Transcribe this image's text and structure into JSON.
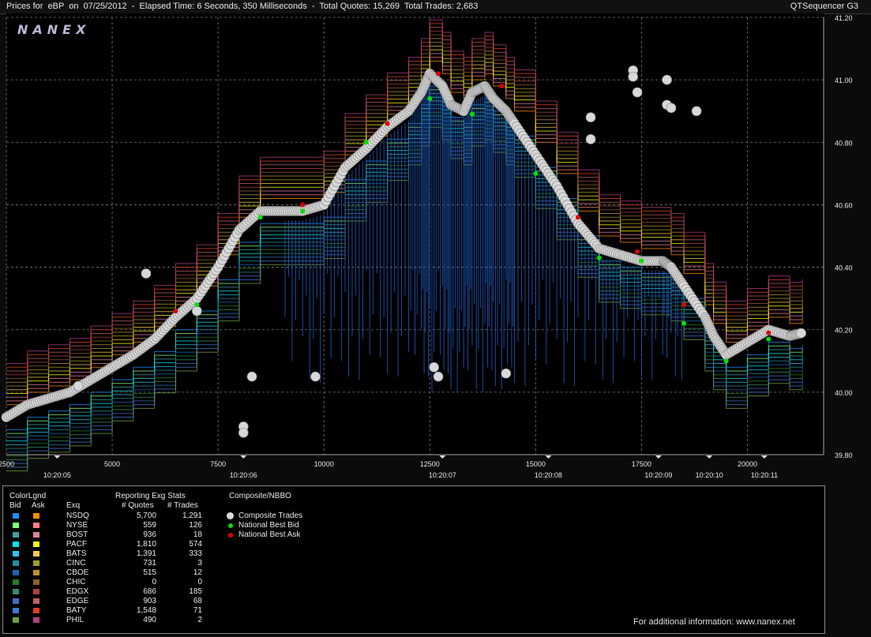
{
  "window": {
    "title": "Prices for  eBP  on  07/25/2012  -  Elapsed Time: 6 Seconds, 350 Milliseconds  -  Total Quotes: 15,269  Total Trades: 2,683",
    "app_name": "QTSequencer G3",
    "watermark": "NANEX"
  },
  "chart_data": {
    "type": "scatter",
    "ylim": [
      39.8,
      41.2
    ],
    "xlim": [
      2500,
      21800
    ],
    "y_ticks": [
      "41.20",
      "41.00",
      "40.80",
      "40.60",
      "40.40",
      "40.20",
      "40.00",
      "39.80"
    ],
    "x_ticks": [
      "2500",
      "5000",
      "7500",
      "10000",
      "12500",
      "15000",
      "17500",
      "20000"
    ],
    "time_labels": [
      "10:20:05",
      "10:20:06",
      "10:20:07",
      "10:20:08",
      "10:20:09",
      "10:20:10",
      "10:20:11"
    ],
    "time_label_x": [
      3700,
      8100,
      12800,
      15300,
      17900,
      19100,
      20400
    ],
    "grid": true,
    "series": [
      {
        "name": "Composite Trades",
        "color": "#d8d8d8",
        "x": [
          2500,
          3000,
          3500,
          4000,
          4500,
          5000,
          5500,
          6000,
          6500,
          7000,
          7500,
          8000,
          8500,
          9000,
          9500,
          10000,
          10500,
          11000,
          11500,
          12000,
          12300,
          12500,
          12800,
          13000,
          13300,
          13500,
          13800,
          14000,
          14300,
          14500,
          15000,
          15500,
          16000,
          16500,
          17000,
          17500,
          18000,
          18200,
          18500,
          19000,
          19200,
          19500,
          20000,
          20500,
          21000,
          21300
        ],
        "y": [
          39.92,
          39.96,
          39.98,
          40.0,
          40.04,
          40.08,
          40.12,
          40.17,
          40.24,
          40.3,
          40.4,
          40.52,
          40.58,
          40.58,
          40.58,
          40.6,
          40.72,
          40.78,
          40.85,
          40.9,
          40.96,
          41.02,
          40.98,
          40.92,
          40.9,
          40.96,
          40.98,
          40.94,
          40.9,
          40.86,
          40.76,
          40.66,
          40.54,
          40.46,
          40.44,
          40.42,
          40.42,
          40.4,
          40.34,
          40.24,
          40.18,
          40.12,
          40.16,
          40.2,
          40.18,
          40.19
        ]
      },
      {
        "name": "National Best Bid",
        "color": "#00e000",
        "x": [
          7000,
          8500,
          9500,
          11000,
          12500,
          13500,
          15000,
          16500,
          17500,
          18500,
          19500,
          20500
        ],
        "y": [
          40.28,
          40.56,
          40.58,
          40.8,
          40.94,
          40.89,
          40.7,
          40.43,
          40.42,
          40.22,
          40.1,
          40.17
        ]
      },
      {
        "name": "National Best Ask",
        "color": "#e00000",
        "x": [
          6500,
          9500,
          11500,
          12700,
          14200,
          16000,
          17400,
          18500,
          20500
        ],
        "y": [
          40.26,
          40.6,
          40.86,
          41.02,
          40.98,
          40.56,
          40.45,
          40.28,
          40.19
        ]
      }
    ],
    "outliers": {
      "x": [
        4200,
        8100,
        8100,
        8300,
        9800,
        12600,
        12700,
        14300,
        16300,
        16300,
        17300,
        17300,
        17400,
        18100,
        18100,
        18200,
        18800,
        7000,
        5800
      ],
      "y": [
        40.02,
        39.89,
        39.87,
        40.05,
        40.05,
        40.08,
        40.05,
        40.06,
        40.88,
        40.81,
        41.03,
        41.01,
        40.96,
        41.0,
        40.92,
        40.91,
        40.9,
        40.26,
        40.38
      ]
    }
  },
  "legend": {
    "header_colorlegend": "ColorLgnd",
    "header_bid": "Bid",
    "header_ask": "Ask",
    "header_stats": "Reporting Exg Stats",
    "header_exq": "Exq",
    "header_quotes": "# Quotes",
    "header_trades": "# Trades",
    "header_composite": "Composite/NBBO",
    "composite_items": [
      {
        "label": "Composite Trades",
        "color": "#d8d8d8"
      },
      {
        "label": "National Best Bid",
        "color": "#00e000"
      },
      {
        "label": "National Best Ask",
        "color": "#e00000"
      }
    ],
    "rows": [
      {
        "exq": "NSDQ",
        "quotes": "5,700",
        "trades": "1,291",
        "bid": "#1e90ff",
        "ask": "#ff8c00"
      },
      {
        "exq": "NYSE",
        "quotes": "559",
        "trades": "126",
        "bid": "#7fff7f",
        "ask": "#ff7f7f"
      },
      {
        "exq": "BOST",
        "quotes": "936",
        "trades": "18",
        "bid": "#40a0a0",
        "ask": "#e080a0"
      },
      {
        "exq": "PACF",
        "quotes": "1,810",
        "trades": "574",
        "bid": "#00e5ee",
        "ask": "#ffff00"
      },
      {
        "exq": "BATS",
        "quotes": "1,391",
        "trades": "333",
        "bid": "#2ec4f0",
        "ask": "#ffc84a"
      },
      {
        "exq": "CINC",
        "quotes": "731",
        "trades": "3",
        "bid": "#2090a0",
        "ask": "#a0a020"
      },
      {
        "exq": "CBOE",
        "quotes": "515",
        "trades": "12",
        "bid": "#2060b0",
        "ask": "#c09030"
      },
      {
        "exq": "CHIC",
        "quotes": "0",
        "trades": "0",
        "bid": "#208020",
        "ask": "#906020"
      },
      {
        "exq": "EDGX",
        "quotes": "686",
        "trades": "185",
        "bid": "#2f8f6f",
        "ask": "#b04040"
      },
      {
        "exq": "EDGE",
        "quotes": "903",
        "trades": "68",
        "bid": "#4070c0",
        "ask": "#c06060"
      },
      {
        "exq": "BATY",
        "quotes": "1,548",
        "trades": "71",
        "bid": "#3c7ad0",
        "ask": "#e04020"
      },
      {
        "exq": "PHIL",
        "quotes": "490",
        "trades": "2",
        "bid": "#70a040",
        "ask": "#b04080"
      }
    ]
  },
  "footer": "For additional information: www.nanex.net"
}
